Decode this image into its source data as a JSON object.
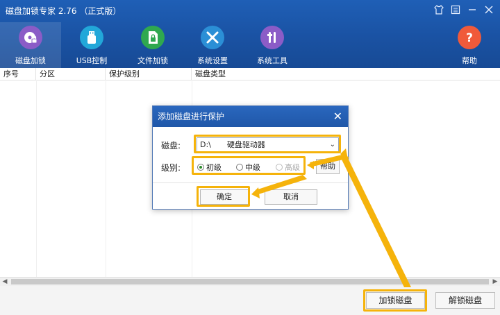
{
  "window": {
    "title": "磁盘加锁专家 2.76 （正式版）",
    "controls": [
      "shirt-icon",
      "settings-icon",
      "minimize-icon",
      "close-icon"
    ]
  },
  "toolbar": {
    "items": [
      {
        "label": "磁盘加锁",
        "icon": "disk-lock-icon",
        "color": "#8b5cc7"
      },
      {
        "label": "USB控制",
        "icon": "usb-icon",
        "color": "#22a7d9"
      },
      {
        "label": "文件加锁",
        "icon": "file-lock-icon",
        "color": "#2fa84f"
      },
      {
        "label": "系统设置",
        "icon": "tools-icon",
        "color": "#2b8fd6"
      },
      {
        "label": "系统工具",
        "icon": "system-tools-icon",
        "color": "#8b5cc7"
      },
      {
        "label": "帮助",
        "icon": "help-icon",
        "color": "#f05a3a"
      }
    ]
  },
  "table": {
    "columns": [
      "序号",
      "分区",
      "保护级别",
      "磁盘类型"
    ]
  },
  "footer": {
    "lock_button": "加锁磁盘",
    "unlock_button": "解锁磁盘"
  },
  "dialog": {
    "title": "添加磁盘进行保护",
    "disk_label": "磁盘:",
    "disk_value_drive": "D:\\",
    "disk_value_type": "硬盘驱动器",
    "level_label": "级别:",
    "levels": [
      {
        "label": "初级",
        "checked": true
      },
      {
        "label": "中级",
        "checked": false
      },
      {
        "label": "高级",
        "checked": false,
        "disabled": true
      }
    ],
    "help_button": "帮助",
    "ok_button": "确定",
    "cancel_button": "取消"
  },
  "colors": {
    "header": "#1a52a3",
    "highlight": "#f5b30b"
  }
}
